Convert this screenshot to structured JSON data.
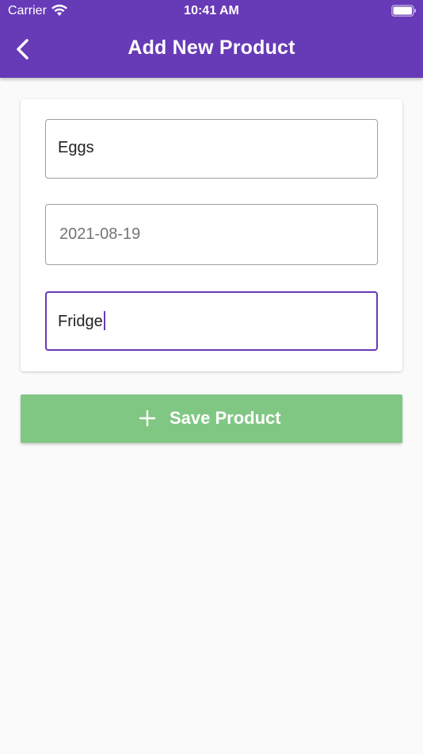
{
  "status_bar": {
    "carrier": "Carrier",
    "time": "10:41 AM",
    "wifi_icon": "wifi-icon",
    "battery_icon": "battery-full-icon"
  },
  "app_bar": {
    "title": "Add New Product",
    "back_icon": "chevron-left-icon",
    "background_color": "#673ab7"
  },
  "form": {
    "name_field": {
      "value": "Eggs"
    },
    "date_field": {
      "placeholder": "2021-08-19"
    },
    "location_field": {
      "value": "Fridge",
      "focused": true
    }
  },
  "save_button": {
    "label": "Save Product",
    "icon": "plus-icon",
    "color": "#81c784"
  },
  "colors": {
    "accent": "#673ab7",
    "background": "#fafafa",
    "border": "#9e9e9e"
  }
}
